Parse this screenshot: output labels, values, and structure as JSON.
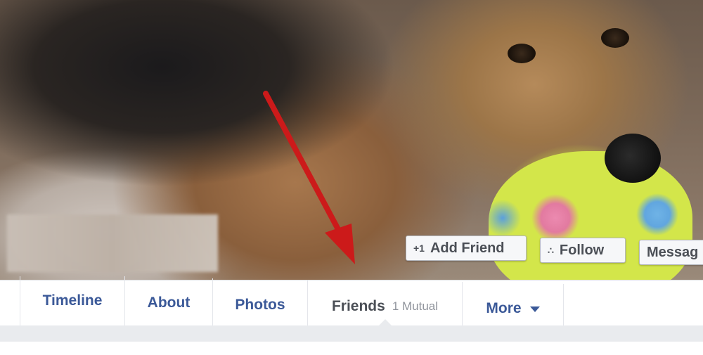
{
  "cover": {
    "actions": {
      "add_friend": {
        "icon": "add-friend-icon",
        "glyph": "+1",
        "label": "Add Friend"
      },
      "follow": {
        "icon": "rss-icon",
        "glyph": "∴",
        "label": "Follow"
      },
      "message": {
        "label": "Messag"
      }
    }
  },
  "tabs": [
    {
      "label": "Timeline"
    },
    {
      "label": "About"
    },
    {
      "label": "Photos"
    },
    {
      "label": "Friends",
      "sub": "1 Mutual"
    },
    {
      "label": "More"
    }
  ],
  "colors": {
    "link_blue": "#3b5998",
    "annotation_arrow": "#cc1a1a"
  }
}
